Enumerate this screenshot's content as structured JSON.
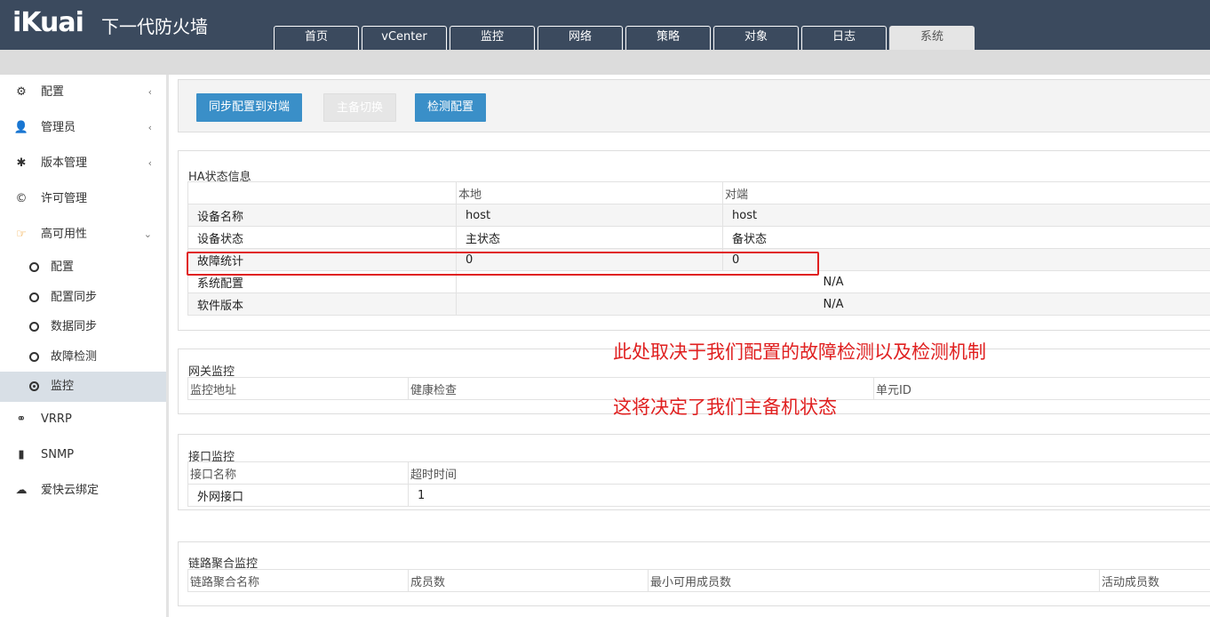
{
  "header": {
    "logo": "iKuai",
    "product": "下一代防火墙",
    "tabs": [
      "首页",
      "vCenter",
      "监控",
      "网络",
      "策略",
      "对象",
      "日志",
      "系统"
    ],
    "active_tab": "系统"
  },
  "sidebar": {
    "items": [
      {
        "label": "配置",
        "icon": "gears-icon",
        "chevron": "‹"
      },
      {
        "label": "管理员",
        "icon": "user-icon",
        "chevron": "‹"
      },
      {
        "label": "版本管理",
        "icon": "gear-icon",
        "chevron": "‹"
      },
      {
        "label": "许可管理",
        "icon": "copyright-icon",
        "chevron": ""
      },
      {
        "label": "高可用性",
        "icon": "hand-pointer-icon",
        "chevron": "⌄"
      }
    ],
    "subitems": [
      "配置",
      "配置同步",
      "数据同步",
      "故障检测",
      "监控"
    ],
    "active_subitem": "监控",
    "bottom_items": [
      {
        "label": "VRRP",
        "icon": "link-icon"
      },
      {
        "label": "SNMP",
        "icon": "bookmark-icon"
      },
      {
        "label": "爱快云绑定",
        "icon": "cloud-icon"
      }
    ]
  },
  "toolbar": {
    "sync_label": "同步配置到对端",
    "switch_label": "主备切换",
    "check_label": "检测配置"
  },
  "ha_status": {
    "title": "HA状态信息",
    "col_local": "本地",
    "col_peer": "对端",
    "rows": [
      {
        "label": "设备名称",
        "local": "host",
        "peer": "host"
      },
      {
        "label": "设备状态",
        "local": "主状态",
        "peer": "备状态"
      },
      {
        "label": "故障统计",
        "local": "0",
        "peer": "0"
      }
    ],
    "merged_rows": [
      {
        "label": "系统配置",
        "value": "N/A"
      },
      {
        "label": "软件版本",
        "value": "N/A"
      }
    ]
  },
  "gateway_monitor": {
    "title": "网关监控",
    "headers": [
      "监控地址",
      "健康检查",
      "单元ID"
    ]
  },
  "interface_monitor": {
    "title": "接口监控",
    "headers": [
      "接口名称",
      "超时时间"
    ],
    "rows": [
      {
        "name": "外网接口",
        "timeout": "1"
      }
    ]
  },
  "lag_monitor": {
    "title": "链路聚合监控",
    "headers": [
      "链路聚合名称",
      "成员数",
      "最小可用成员数",
      "活动成员数"
    ]
  },
  "annotations": {
    "line1": "此处取决于我们配置的故障检测以及检测机制",
    "line2": "这将决定了我们主备机状态",
    "color": "#e02020"
  }
}
